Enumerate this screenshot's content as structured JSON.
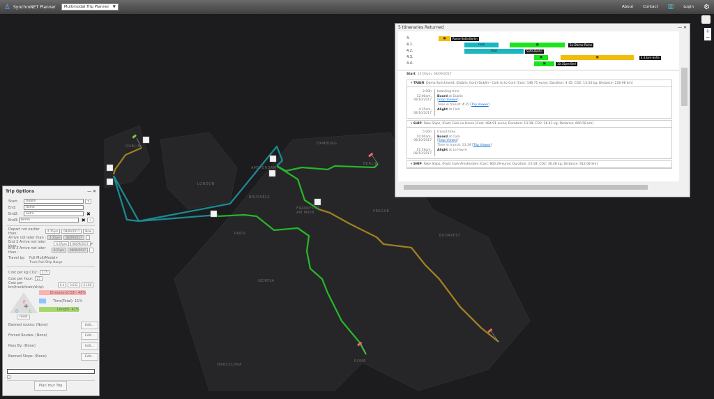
{
  "topbar": {
    "app_name": "SynchroNET Planner",
    "planner_select": "Multimodal Trip Planner",
    "about": "About",
    "contact": "Contact",
    "login": "Login"
  },
  "map": {
    "cities": [
      "DUBLIN",
      "LONDON",
      "AMSTERDAM",
      "BRUSSELS",
      "PARIS",
      "HAMBURG",
      "BERLIN",
      "FRANKFURT AM MAIN",
      "PRAGUE",
      "GENEVA",
      "BUDAPEST",
      "BARCELONA",
      "ROME"
    ],
    "zoom_in": "+",
    "zoom_out": "−"
  },
  "itineraries": {
    "title": "5 Itineraries Returned",
    "rows": [
      {
        "id": "4.",
        "labels": [
          "Rome-Sofia-Berlin"
        ]
      },
      {
        "id": "4.1.",
        "bars": [
          "Fast"
        ],
        "labels": [
          "2a-Dlemo-Rome"
        ]
      },
      {
        "id": "4.2.",
        "bars": [
          "Fast"
        ],
        "labels": [
          "Sofia-Berlin"
        ]
      },
      {
        "id": "4.3.",
        "labels": [
          "4:33am-Sofia"
        ]
      },
      {
        "id": "4.4.",
        "labels": [
          "10:35pm-Berl"
        ]
      }
    ],
    "start_label": "Start",
    "start_time": "10:00pm, 08/09/2017",
    "segments": [
      {
        "mode": "TRAIN",
        "desc": ": Damo Synchronet, (Dublin_Cork) Dublin - Cork to to Cork [Cost: 146.71 euros; Duration: 4:35; CO2: 13.54 kg; Distance: 218.98 km]",
        "wait": "2:00h",
        "wait_label": "boarding time",
        "board_time": "12:00am, 08/10/2017",
        "board": "Board",
        "board_at": " at Dublin",
        "stop_viewer": "Stop Viewer",
        "transit": "Time in transit: 4:35",
        "trip_viewer": "Trip Viewer",
        "alight_time": "4:35am, 08/10/2017",
        "alight": "Alight",
        "alight_at": " at Cork"
      },
      {
        "mode": "SHIP",
        "desc": ": Fake Ships, (Fast) Cork-Le Havre [Cost: 484.91 euros; Duration: 13:39; CO2: 26.41 kg; Distance: 660.58 km]",
        "wait": "5:00h",
        "wait_label": "transit time",
        "board_time": "10:00am, 08/10/2017",
        "board": "Board",
        "board_at": " at Cork",
        "stop_viewer": "Stop Viewer",
        "transit": "Time in transit: 13:39",
        "trip_viewer": "Trip Viewer",
        "alight_time": "11:39pm, 08/10/2017",
        "alight": "Alight",
        "alight_at": " at Le Havre"
      },
      {
        "mode": "SHIP",
        "desc": ": Fake Ships, (Fast) Cork-Amsterdam [Cost: 803.29 euros; Duration: 23:18; CO2: 36.48 kg; Distance: 912.08 km]"
      }
    ]
  },
  "trip_options": {
    "title": "Trip Options",
    "start_label": "Start:",
    "start": "Dublin",
    "end_label": "End:",
    "end": "Rome",
    "end2_label": "End2:",
    "end2": "Sofia",
    "end3_label": "End3:",
    "end3": "Berlin",
    "depart_label": "Depart not earlier than:",
    "depart_time": "4:35pm",
    "depart_date": "08/09/2017",
    "now": "Now",
    "arrive_label": "Arrive not later than :",
    "arrive_time": "4:35pm",
    "arrive_date": "08/09/2017",
    "end2_arrive_label": "End 2 Arrive not later than :",
    "end2_arrive_time": "4:37pm",
    "end2_arrive_date": "08/09/2017",
    "end3_arrive_label": "End 3 Arrive not later than :",
    "end3_arrive_time": "4:37pm",
    "end3_arrive_date": "08/09/2017",
    "travel_by": "Travel by:",
    "full_multimodal": "Full MultiModal",
    "modes": "Truck Rail Ship Barge",
    "co2_label": "Cost per kg CO2:",
    "co2": "1.15",
    "hour_label": "Cost per hour:",
    "hour": "25",
    "km_label": "Cost per km(truck/train/ship):",
    "km": [
      "0.4",
      "0.032",
      "0.108"
    ],
    "emission": "Emission(CO2): 48%",
    "time": "Time(Total): 11%",
    "length": "Length: 41%",
    "emission_pct": 48,
    "time_pct": 11,
    "length_pct": 41,
    "tri": [
      "E",
      "D",
      "L"
    ],
    "reset": "reset",
    "banned_routes": "Banned routes: (None)",
    "forced_routes": "Forced Routes: (None)",
    "pass_by": "Pass By: (None)",
    "banned_stops": "Banned Stops: (None)",
    "edit": "Edit...",
    "plan": "Plan Your Trip"
  }
}
